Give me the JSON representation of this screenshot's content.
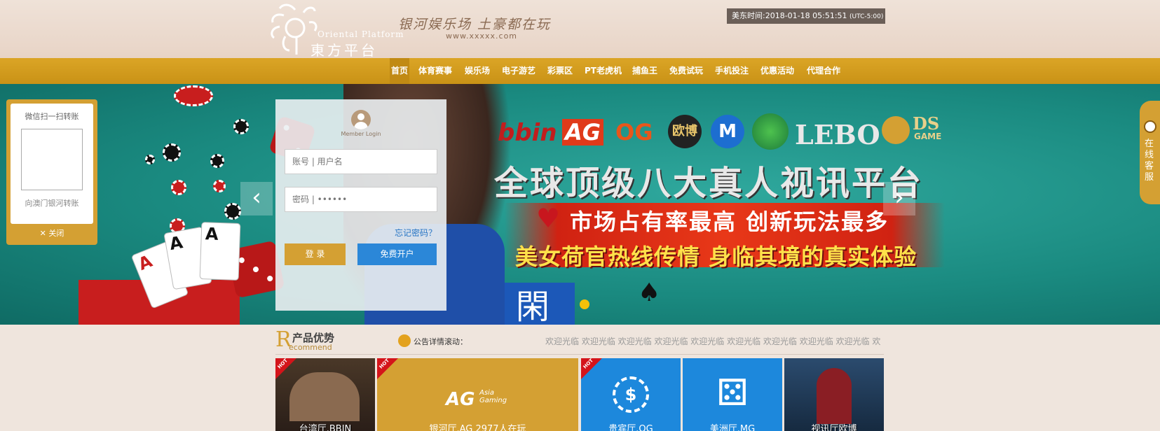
{
  "header": {
    "logo_en": "Oriental Platform",
    "logo_cn": "東方平台",
    "slogan": "银河娱乐场 土豪都在玩",
    "slogan_url": "www.xxxxx.com",
    "clock_label": "美东时间:",
    "clock_value": "2018-01-18 05:51:51",
    "clock_tz": "(UTC-5:00)"
  },
  "nav": {
    "items": [
      {
        "label": "首页"
      },
      {
        "label": "体育赛事"
      },
      {
        "label": "娱乐场"
      },
      {
        "label": "电子游艺"
      },
      {
        "label": "彩票区"
      },
      {
        "label": "PT老虎机"
      },
      {
        "label": "捕鱼王"
      },
      {
        "label": "免费试玩"
      },
      {
        "label": "手机投注"
      },
      {
        "label": "优惠活动"
      },
      {
        "label": "代理合作"
      }
    ],
    "hot_label": "HOT"
  },
  "banner": {
    "brands": [
      "bbin",
      "AG",
      "OG",
      "欧博",
      "M",
      "",
      "LEBO",
      "DS",
      "GAME"
    ],
    "headline": "全球顶级八大真人视讯平台",
    "line2": "市场占有率最高  创新玩法最多",
    "line3": "美女荷官热线传情  身临其境的真实体验",
    "panel_glyph": "閑",
    "prev_glyph": "‹",
    "next_glyph": "›"
  },
  "login": {
    "member_label": "Member Login",
    "account_placeholder": "账号 | 用户名",
    "password_placeholder": "密码 | ••••••",
    "forgot": "忘记密码？",
    "login_button": "登 录",
    "register_button": "免费开户",
    "colors": {
      "login": "#d4a033",
      "register": "#2b87d8"
    }
  },
  "qr_panel": {
    "title": "微信扫一扫转账",
    "footer": "向澳门银河转账",
    "close": "✕ 关闭"
  },
  "service": {
    "label": "在线客服"
  },
  "recommend": {
    "r": "R",
    "title_cn": "产品优势",
    "title_en": "ecommend",
    "notice_label": "公告详情滚动：",
    "marquee": "欢迎光临 欢迎光临 欢迎光临 欢迎光临 欢迎光临 欢迎光临 欢迎光临 欢迎光临 欢迎光临 欢"
  },
  "tiles": [
    {
      "label": "台湾厅.BBIN",
      "hot": true,
      "color": "#3a2a20",
      "icon": ""
    },
    {
      "label": "银河厅.AG 2977人在玩",
      "hot": true,
      "color": "#d4a033",
      "icon": "AG",
      "sub": "Asia Gaming"
    },
    {
      "label": "贵宾厅.OG",
      "hot": true,
      "color": "#1d88dc",
      "icon": "$"
    },
    {
      "label": "美洲厅.MG",
      "hot": false,
      "color": "#1d88dc",
      "icon": "⚄"
    },
    {
      "label": "视讯厅欧博",
      "hot": false,
      "color": "#1e3a5a",
      "icon": ""
    }
  ]
}
